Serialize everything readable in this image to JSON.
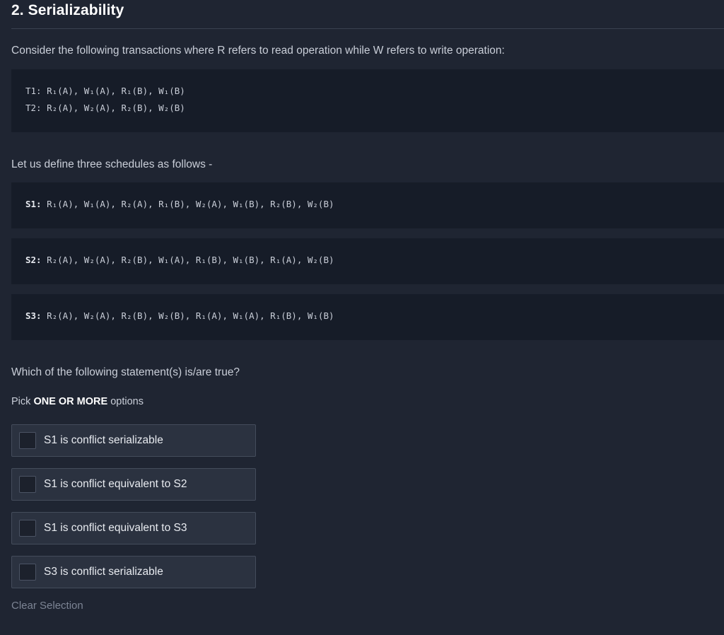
{
  "question": {
    "title": "2. Serializability",
    "intro": "Consider the following transactions where R refers to read operation while W refers to write operation:",
    "transactions": [
      {
        "label": "T1:",
        "ops": "R₁(A), W₁(A), R₁(B), W₁(B)"
      },
      {
        "label": "T2:",
        "ops": "R₂(A), W₂(A), R₂(B), W₂(B)"
      }
    ],
    "schedules_intro": "Let us define three schedules as follows -",
    "schedules": [
      {
        "label": "S1:",
        "ops": "R₁(A), W₁(A), R₂(A), R₁(B), W₂(A), W₁(B), R₂(B), W₂(B)"
      },
      {
        "label": "S2:",
        "ops": "R₂(A), W₂(A), R₂(B), W₁(A), R₁(B), W₁(B), R₁(A), W₂(B)"
      },
      {
        "label": "S3:",
        "ops": "R₂(A), W₂(A), R₂(B), W₂(B), R₁(A), W₁(A), R₁(B), W₁(B)"
      }
    ],
    "prompt": "Which of the following statement(s) is/are true?",
    "pick_prefix": "Pick",
    "pick_bold": "ONE OR MORE",
    "pick_suffix": "options",
    "options": [
      "S1 is conflict serializable",
      "S1 is conflict equivalent to S2",
      "S1 is conflict equivalent to S3",
      "S3 is conflict serializable"
    ],
    "clear_label": "Clear Selection"
  }
}
